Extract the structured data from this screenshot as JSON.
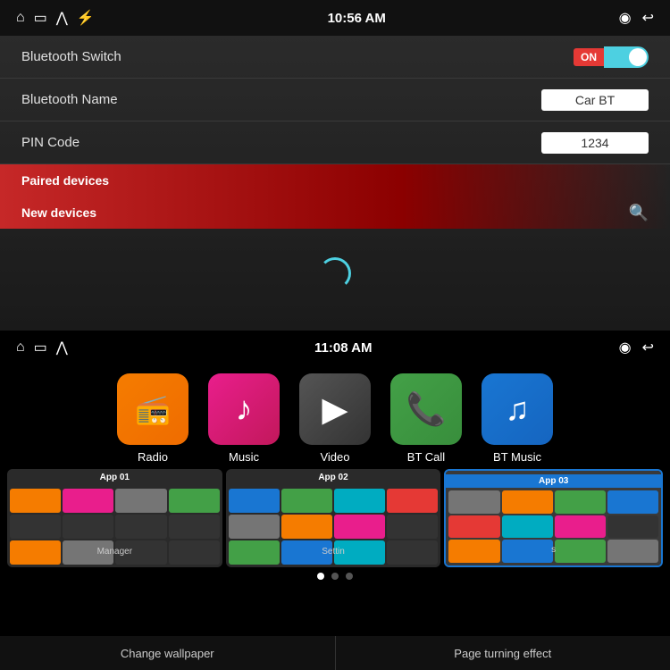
{
  "top": {
    "statusBar": {
      "time": "10:56 AM",
      "icons": [
        "home",
        "screen",
        "chevrons-up",
        "usb"
      ],
      "rightIcons": [
        "location",
        "back"
      ]
    },
    "rows": [
      {
        "label": "Bluetooth Switch",
        "type": "toggle",
        "toggleState": "ON"
      },
      {
        "label": "Bluetooth Name",
        "type": "input",
        "value": "Car BT"
      },
      {
        "label": "PIN Code",
        "type": "input",
        "value": "1234"
      }
    ],
    "sections": [
      {
        "label": "Paired devices"
      },
      {
        "label": "New devices",
        "hasSearch": true
      }
    ]
  },
  "bottom": {
    "statusBar": {
      "time": "11:08 AM",
      "icons": [
        "home",
        "screen",
        "chevrons-up"
      ],
      "rightIcons": [
        "location",
        "back"
      ]
    },
    "apps": [
      {
        "id": "radio",
        "label": "Radio",
        "icon": "📻",
        "colorClass": "app-radio"
      },
      {
        "id": "music",
        "label": "Music",
        "icon": "♪",
        "colorClass": "app-music"
      },
      {
        "id": "video",
        "label": "Video",
        "icon": "▶",
        "colorClass": "app-video"
      },
      {
        "id": "btcall",
        "label": "BT Call",
        "icon": "📞",
        "colorClass": "app-btcall"
      },
      {
        "id": "btmusic",
        "label": "BT Music",
        "icon": "♫",
        "colorClass": "app-btmusic"
      }
    ],
    "thumbs": [
      {
        "id": "app01",
        "title": "App 01",
        "active": false,
        "bottomLabel": "Manager"
      },
      {
        "id": "app02",
        "title": "App 02",
        "active": false,
        "bottomLabel": "Settin"
      },
      {
        "id": "app03",
        "title": "App 03",
        "active": true,
        "bottomLabel": "s"
      }
    ],
    "dots": [
      true,
      false,
      false
    ],
    "bottomBar": [
      {
        "label": "Change wallpaper"
      },
      {
        "label": "Page turning effect"
      }
    ]
  }
}
